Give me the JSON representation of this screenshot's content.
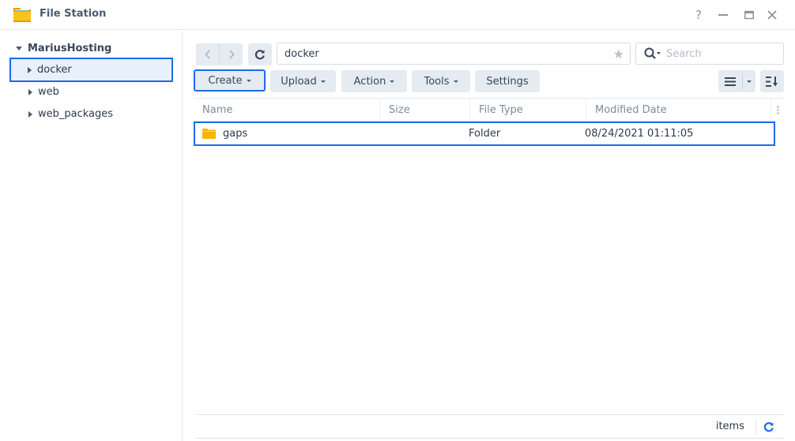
{
  "window": {
    "title": "File Station",
    "icon": "file-station-folder-icon",
    "controls": [
      "help-icon",
      "minimize-icon",
      "maximize-icon",
      "close-icon"
    ],
    "help_label": "?"
  },
  "sidebar": {
    "root": {
      "label": "MariusHosting",
      "expanded": true
    },
    "items": [
      {
        "label": "docker",
        "selected": true
      },
      {
        "label": "web",
        "selected": false
      },
      {
        "label": "web_packages",
        "selected": false
      }
    ]
  },
  "toolbar": {
    "path": "docker",
    "search_placeholder": "Search",
    "buttons": {
      "create": "Create",
      "upload": "Upload",
      "action": "Action",
      "tools": "Tools",
      "settings": "Settings"
    }
  },
  "grid": {
    "columns": [
      "Name",
      "Size",
      "File Type",
      "Modified Date"
    ],
    "rows": [
      {
        "name": "gaps",
        "size": "",
        "type": "Folder",
        "modified": "08/24/2021 01:11:05"
      }
    ]
  },
  "footer": {
    "items_label": "items"
  },
  "colors": {
    "accent": "#1a6ce8",
    "folder": "#f5b400",
    "button_bg": "#e6ebf2"
  }
}
